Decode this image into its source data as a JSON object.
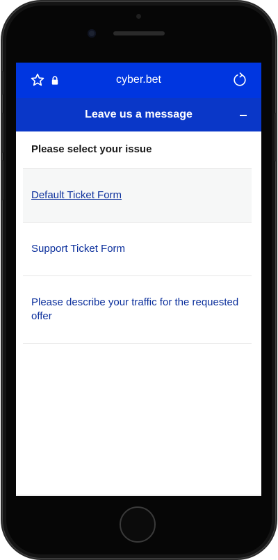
{
  "browser": {
    "url": "cyber.bet",
    "icons": {
      "bookmark": "star-icon",
      "secure": "lock-icon",
      "reload": "reload-icon"
    },
    "bar_color": "#0036e0"
  },
  "widget": {
    "title": "Leave us a message",
    "minimize": "minimize-icon",
    "header_color": "#0a37c8",
    "prompt": "Please select your issue",
    "issues": [
      {
        "label": "Default Ticket Form",
        "state": "hover"
      },
      {
        "label": "Support Ticket Form"
      },
      {
        "label": "Please describe your traffic for the requested offer"
      }
    ],
    "link_color": "#0b2f9c"
  },
  "device": {
    "home_button": "home-button-icon"
  }
}
